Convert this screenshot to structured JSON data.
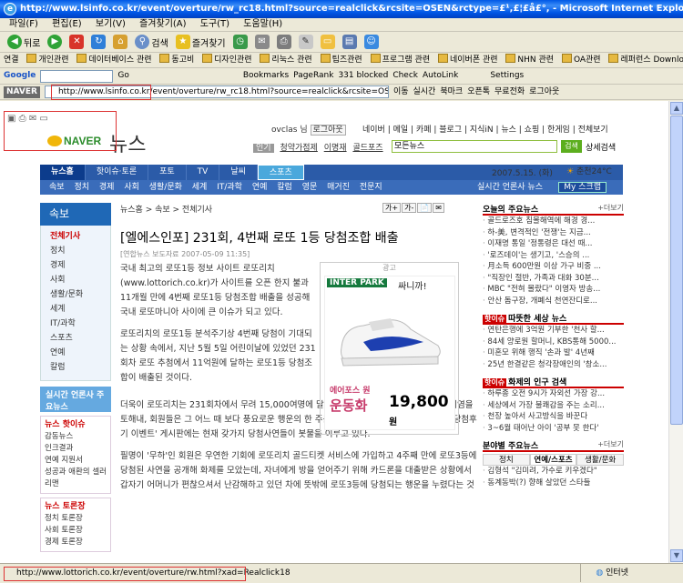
{
  "window": {
    "title": "http://www.lsinfo.co.kr/event/overture/rw_rc18.html?source=realclick&rcsite=OSEN&rctype=£¹,£¦£å£°, - Microsoft Internet Explorer"
  },
  "menu": [
    "파일(F)",
    "편집(E)",
    "보기(V)",
    "즐겨찾기(A)",
    "도구(T)",
    "도움말(H)"
  ],
  "toolbar": {
    "back": "뒤로",
    "search": "검색",
    "favorites": "즐겨찾기"
  },
  "links": {
    "label": "연결",
    "items": [
      "개인관련",
      "데이터베이스 관련",
      "동고비",
      "디자인관련",
      "리눅스 관련",
      "팁즈관련",
      "프로그램 관련",
      "네이버폰 관련",
      "NHN 관련",
      "OA관련",
      "레퍼런스 Downloads"
    ]
  },
  "google_bar": {
    "logo": "Google",
    "go": "Go",
    "bookmarks": "Bookmarks",
    "pagerank": "PageRank",
    "blocked": "331 blocked",
    "check": "Check",
    "autolink": "AutoLink",
    "settings": "Settings"
  },
  "naver_bar": {
    "label": "NAVER",
    "address": "http://www.lsinfo.co.kr/event/overture/rw_rc18.html?source=realclick&rcsite=OSEN&rctype=¹",
    "go": "이동",
    "realtime": "실시간",
    "bookmark": "북마크",
    "open_dict": "오픈톡",
    "free_call": "무료전화",
    "kao": "로그아웃"
  },
  "naver_header": {
    "logo": "NAVER",
    "news": "뉴스",
    "user": "ovclas 님",
    "logout": "로그아웃",
    "top_links": "네이버 | 메일 | 카페 | 블로그 | 지식iN | 뉴스 | 쇼핑 | 한게임 | 전체보기",
    "popular_tag": "인기",
    "popular_keywords": [
      "청약가점제",
      "이명재",
      "골드포즈"
    ],
    "search_scope": "모든뉴스",
    "search_btn": "검색",
    "detail_search": "상세검색"
  },
  "gnb": [
    "뉴스홈",
    "핫이슈·토론",
    "포토",
    "TV",
    "날씨",
    "스포츠"
  ],
  "date": "2007.5.15. (화)",
  "weather": "춘천24°C",
  "sub_gnb": [
    "속보",
    "정치",
    "경제",
    "사회",
    "생활/문화",
    "세계",
    "IT/과학",
    "연예",
    "칼럼",
    "영문",
    "매거진",
    "전문지"
  ],
  "sub_gnb_right": {
    "realtime": "실시간 언론사 뉴스",
    "myscrap": "My 스크랩"
  },
  "lnb": {
    "head": "속보",
    "items": [
      "전체기사",
      "정치",
      "경제",
      "사회",
      "생활/문화",
      "세계",
      "IT/과학",
      "스포츠",
      "연예",
      "칼럼"
    ],
    "realtime": "실시간 언론사 주요뉴스",
    "hot_head": "뉴스 핫이슈",
    "hot_items": [
      "감동뉴스",
      "인크결과",
      "연예 지원서",
      "성공과 애환의 셀러리맨"
    ],
    "debate_head": "뉴스 토론장",
    "debate_items": [
      "정치 토론장",
      "사회 토론장",
      "경제 토론장"
    ]
  },
  "article": {
    "crumb": "뉴스홈 > 속보 > 전체기사",
    "buttons": [
      "가+",
      "가-",
      "📄",
      "✉"
    ],
    "title": "[엘에스인포] 231회, 4번째 로또 1등 당첨조합 배출",
    "meta": "[연합뉴스 보도자료 2007-05-09 11:35]",
    "p1": "국내 최고의 로또1등 정보 사이트 로또리치(www.lottorich.co.kr)가 사이트를 오픈 한지 불과 11개월 만에 4번째 로또1등 당첨조합 배출을 성공해 국내 로또마니아 사이에 큰 이슈가 되고 있다.",
    "p2": "로또리치의 로또1등 분석주기상 4번째 당첨이 기대되는 상황 속에서, 지난 5월 5일 어린이날에 있었던 231회차 로또 추첨에서 11억원에 달하는 로또1등 당첨조합이 배출된 것이다.",
    "p3": "더욱이 로또리치는 231회차에서 무려 15,000여명에 달하는 엄청난 당첨자를 배출해 내는 기염을 토해내, 회원들은 그 어느 때 보다 풍요로운 행운의 한 주를 보냈다. 이와 관련해 로또리치의 '당첨후기 이벤트' 게시판에는 현재 갖가지 당첨사연들이 봇물을 이루고 있다.",
    "p4": "필명이 '무하'인 회원은 우연한 기회에 로또리치 골드티켓 서비스에 가입하고 4주째 만에 로또3등에 당첨된 사연을 공개해 화제를 모았는데, 자녀에게 방을 얻어주기 위해 카드론을 대출받은 상황에서 갑자기 어머니가 편찮으셔서 난감해하고 있던 차에 뜻밖에 로또3등에 당첨되는 행운을 누렸다는 것"
  },
  "ad": {
    "label": "광고",
    "brand": "INTER PARK",
    "slogan": "싸니까!",
    "line1": "에어포스 원",
    "line2": "운동화",
    "price": "19,800",
    "won": "원"
  },
  "right": {
    "s1_title": "오늘의 주요뉴스",
    "s1_more": "+더보기",
    "s1_items": [
      "골드로즈호 침몰해역에 해경 경...",
      "하-美, 변격적인 '전쟁'는 지금...",
      "이재명 통일 '정통령은 대선 때...",
      "'로즈데이'는 생기고, '스승의 ...",
      "月소득 600만원 이상 가구 비중 ...",
      "\"직장인 절반, 가족과 대화 30분...",
      "MBC \"전혀 몰랐다\" 이영자 방송...",
      "안산 돔구장, 개폐식 천연잔디로..."
    ],
    "s2_title": "따뜻한 세상 뉴스",
    "s2_items": [
      "연탄은행에 3억원 기부한 '천사 할...",
      "84세 양로원 할머니, KBS통해 5000...",
      "미혼모 위해 행직 '손과 발' 4년째",
      "25년 한결같은 청각장애인의 '창소..."
    ],
    "s3_title": "화제의 인구 검색",
    "s3_items": [
      "하루종 오전 9시가 자외선 가장 강...",
      "세상에서 가장 불쾌감을 주는 소리...",
      "천장 높아서 사고방식을 바꾼다",
      "3~6월 태어난 아이 '공부 못 한다'"
    ],
    "s4_title": "분야별 주요뉴스",
    "s4_more": "+더보기",
    "s4_tabs": [
      "정치",
      "연예/스포츠",
      "생활/문화"
    ],
    "s4_items": [
      "김형석 \"김미려, 가수로 키우겠다\"",
      "동계동박(?) 향해 살았던 스타들"
    ]
  },
  "status": {
    "url": "http://www.lottorich.co.kr/event/overture/rw.html?xad=Realclick18",
    "zone": "인터넷"
  }
}
